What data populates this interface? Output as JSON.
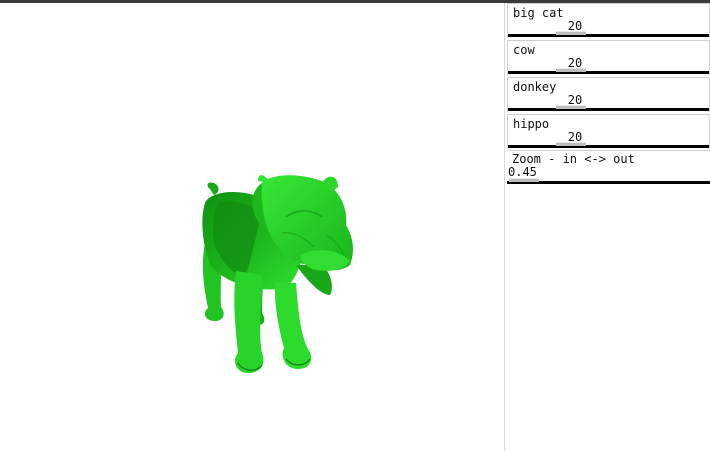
{
  "viewport": {
    "model_name": "big cat",
    "model_color": "#22cc22"
  },
  "controls": [
    {
      "label": "big cat",
      "value": "20"
    },
    {
      "label": "cow",
      "value": "20"
    },
    {
      "label": "donkey",
      "value": "20"
    },
    {
      "label": "hippo",
      "value": "20"
    }
  ],
  "zoom": {
    "label": "Zoom - in <-> out",
    "value": "0.45"
  }
}
